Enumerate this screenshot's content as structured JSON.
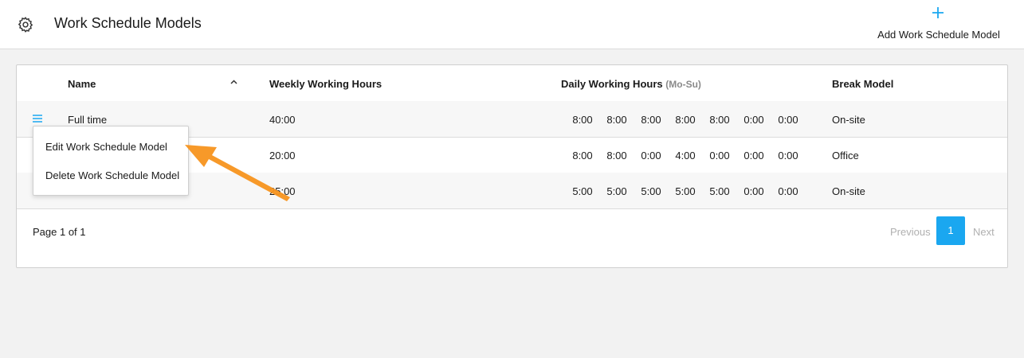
{
  "header": {
    "title": "Work Schedule Models",
    "add_button_label": "Add Work Schedule Model",
    "settings_icon": "gear-icon",
    "add_icon": "plus-icon"
  },
  "table": {
    "columns": {
      "name": "Name",
      "weekly": "Weekly Working Hours",
      "daily": "Daily Working Hours",
      "daily_sub": "(Mo-Su)",
      "break_model": "Break Model"
    },
    "rows": [
      {
        "name": "Full time",
        "weekly": "40:00",
        "days": [
          "8:00",
          "8:00",
          "8:00",
          "8:00",
          "8:00",
          "0:00",
          "0:00"
        ],
        "break_model": "On-site"
      },
      {
        "name": "",
        "weekly": "20:00",
        "days": [
          "8:00",
          "8:00",
          "0:00",
          "4:00",
          "0:00",
          "0:00",
          "0:00"
        ],
        "break_model": "Office"
      },
      {
        "name": "",
        "weekly": "25:00",
        "days": [
          "5:00",
          "5:00",
          "5:00",
          "5:00",
          "5:00",
          "0:00",
          "0:00"
        ],
        "break_model": "On-site"
      }
    ]
  },
  "row_menu": {
    "edit": "Edit Work Schedule Model",
    "delete": "Delete Work Schedule Model"
  },
  "pagination": {
    "info": "Page 1 of 1",
    "previous": "Previous",
    "current": "1",
    "next": "Next"
  },
  "colors": {
    "accent": "#1aa7f0",
    "arrow": "#f7941d"
  }
}
